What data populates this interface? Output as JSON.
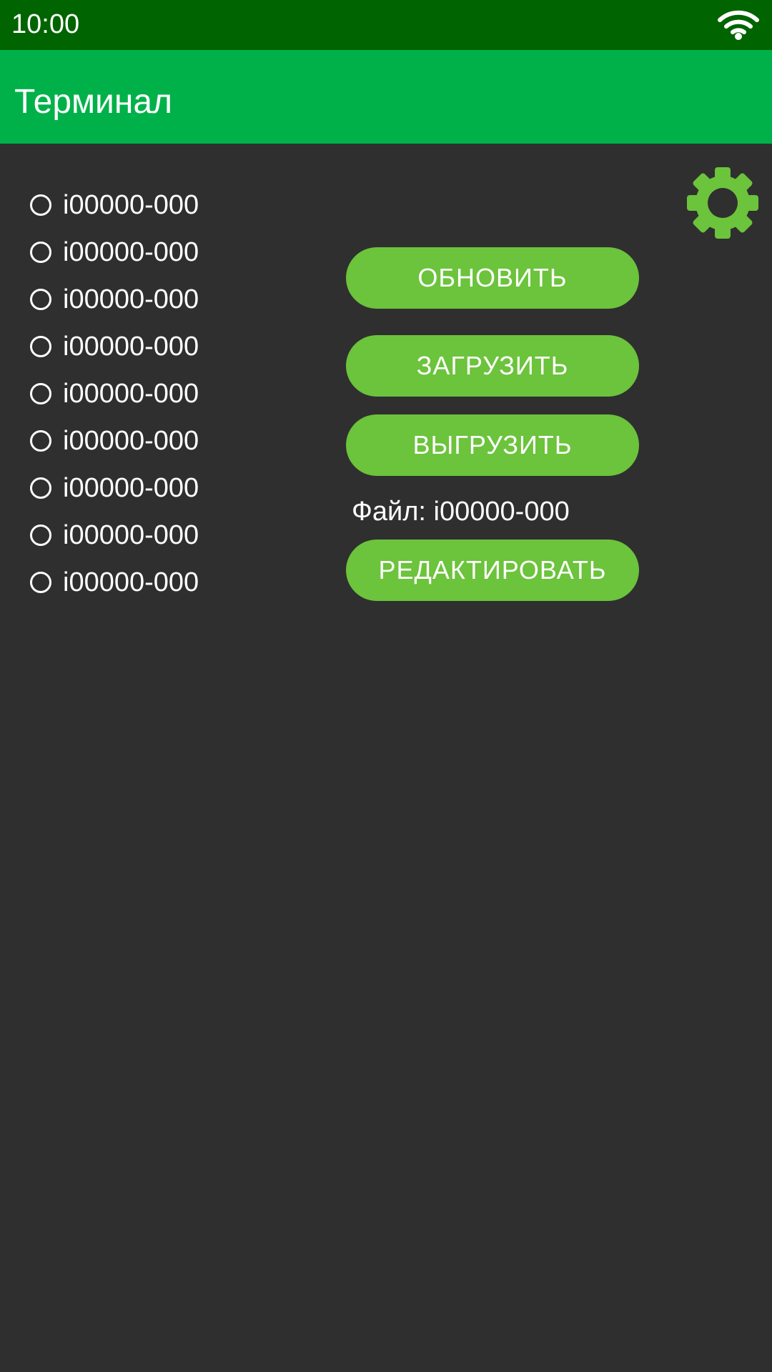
{
  "status_bar": {
    "time": "10:00",
    "wifi_icon": "wifi-icon"
  },
  "app_bar": {
    "title": "Терминал"
  },
  "settings": {
    "icon": "gear-icon",
    "color": "#6cc33c"
  },
  "file_list": {
    "items": [
      {
        "label": "i00000-000",
        "selected": false
      },
      {
        "label": "i00000-000",
        "selected": false
      },
      {
        "label": "i00000-000",
        "selected": false
      },
      {
        "label": "i00000-000",
        "selected": false
      },
      {
        "label": "i00000-000",
        "selected": false
      },
      {
        "label": "i00000-000",
        "selected": false
      },
      {
        "label": "i00000-000",
        "selected": false
      },
      {
        "label": "i00000-000",
        "selected": false
      },
      {
        "label": "i00000-000",
        "selected": false
      }
    ]
  },
  "actions": {
    "refresh_label": "ОБНОВИТЬ",
    "download_label": "ЗАГРУЗИТЬ",
    "upload_label": "ВЫГРУЗИТЬ",
    "file_prefix": "Файл: ",
    "file_name": "i00000-000",
    "edit_label": "РЕДАКТИРОВАТЬ"
  },
  "colors": {
    "status_bar": "#006400",
    "app_bar": "#00b14a",
    "background": "#2f2f2f",
    "button": "#6cc33c",
    "text": "#ffffff"
  }
}
